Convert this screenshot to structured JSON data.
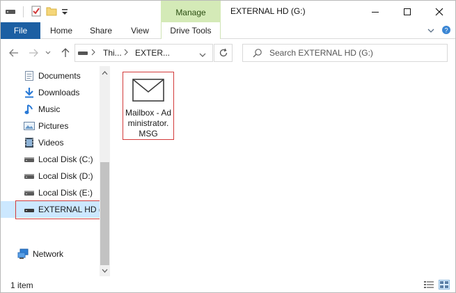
{
  "window": {
    "title": "EXTERNAL HD (G:)",
    "contextual_tab": "Manage"
  },
  "ribbon": {
    "file": "File",
    "tabs": [
      "Home",
      "Share",
      "View",
      "Drive Tools"
    ]
  },
  "address": {
    "crumbs": [
      "Thi...",
      "EXTER..."
    ]
  },
  "search": {
    "placeholder": "Search EXTERNAL HD (G:)"
  },
  "navigation": {
    "items": [
      {
        "label": "Documents",
        "icon": "documents-icon"
      },
      {
        "label": "Downloads",
        "icon": "downloads-icon"
      },
      {
        "label": "Music",
        "icon": "music-icon"
      },
      {
        "label": "Pictures",
        "icon": "pictures-icon"
      },
      {
        "label": "Videos",
        "icon": "videos-icon"
      },
      {
        "label": "Local Disk (C:)",
        "icon": "drive-icon"
      },
      {
        "label": "Local Disk (D:)",
        "icon": "drive-icon"
      },
      {
        "label": "Local Disk (E:)",
        "icon": "drive-icon"
      },
      {
        "label": "EXTERNAL HD (G:)",
        "icon": "drive-icon",
        "selected": true
      },
      {
        "label": "Network",
        "icon": "network-icon"
      }
    ]
  },
  "content": {
    "files": [
      {
        "name": "Mailbox - Administrator.MSG",
        "icon": "envelope-icon"
      }
    ]
  },
  "status": {
    "item_count": "1 item"
  },
  "colors": {
    "file_tab": "#1c5fa3",
    "manage_tab": "#d4eab7",
    "selection": "#cce8ff",
    "highlight_border": "#d23a3a"
  }
}
